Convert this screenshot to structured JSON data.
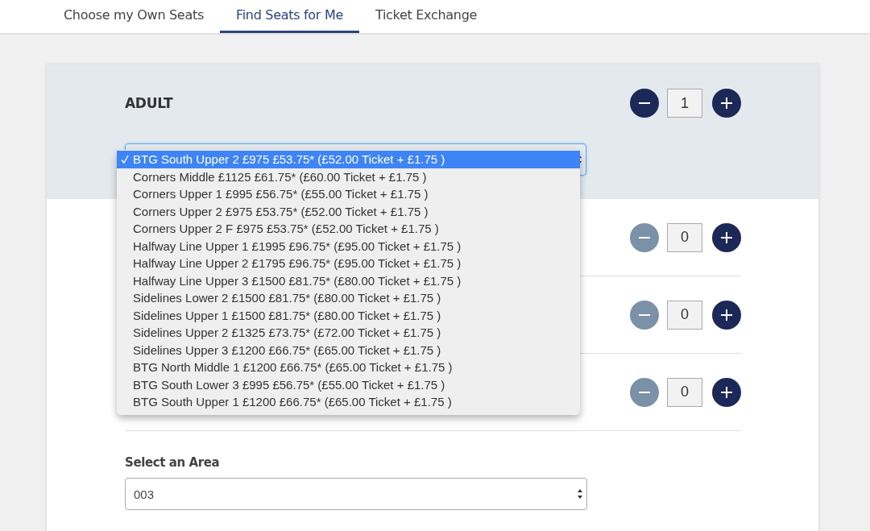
{
  "tabs": [
    {
      "label": "Choose my Own Seats",
      "selected": false
    },
    {
      "label": "Find Seats for Me",
      "selected": true
    },
    {
      "label": "Ticket Exchange",
      "selected": false
    }
  ],
  "ticket_rows": [
    {
      "label": "ADULT",
      "highlighted": true,
      "quantity": "1",
      "minus_disabled": false
    },
    {
      "highlighted": false,
      "quantity": "0",
      "minus_disabled": true
    },
    {
      "highlighted": false,
      "quantity": "0",
      "minus_disabled": true
    },
    {
      "highlighted": false,
      "quantity": "0",
      "minus_disabled": true
    }
  ],
  "price_band_dropdown": {
    "options": [
      {
        "label": "BTG South Upper 2 £975 £53.75* (£52.00 Ticket + £1.75 )",
        "selected": true
      },
      {
        "label": "Corners Middle £1125 £61.75* (£60.00 Ticket + £1.75 )",
        "selected": false
      },
      {
        "label": "Corners Upper 1 £995 £56.75* (£55.00 Ticket + £1.75 )",
        "selected": false
      },
      {
        "label": "Corners Upper 2 £975 £53.75* (£52.00 Ticket + £1.75 )",
        "selected": false
      },
      {
        "label": "Corners Upper 2 F £975 £53.75* (£52.00 Ticket + £1.75 )",
        "selected": false
      },
      {
        "label": "Halfway Line Upper 1 £1995 £96.75* (£95.00 Ticket + £1.75 )",
        "selected": false
      },
      {
        "label": "Halfway Line Upper 2 £1795 £96.75* (£95.00 Ticket + £1.75 )",
        "selected": false
      },
      {
        "label": "Halfway Line Upper 3 £1500 £81.75* (£80.00 Ticket + £1.75 )",
        "selected": false
      },
      {
        "label": "Sidelines Lower 2 £1500 £81.75* (£80.00 Ticket + £1.75 )",
        "selected": false
      },
      {
        "label": "Sidelines Upper 1 £1500 £81.75* (£80.00 Ticket + £1.75 )",
        "selected": false
      },
      {
        "label": "Sidelines Upper 2 £1325 £73.75* (£72.00 Ticket + £1.75 )",
        "selected": false
      },
      {
        "label": "Sidelines Upper 3 £1200 £66.75* (£65.00 Ticket + £1.75 )",
        "selected": false
      },
      {
        "label": "BTG North Middle 1 £1200 £66.75* (£65.00 Ticket + £1.75 )",
        "selected": false
      },
      {
        "label": "BTG South Lower 3 £995 £56.75* (£55.00 Ticket + £1.75 )",
        "selected": false
      },
      {
        "label": "BTG South Upper 1 £1200 £66.75* (£65.00 Ticket + £1.75 )",
        "selected": false
      }
    ]
  },
  "area_select": {
    "label": "Select an Area",
    "value": "003"
  }
}
